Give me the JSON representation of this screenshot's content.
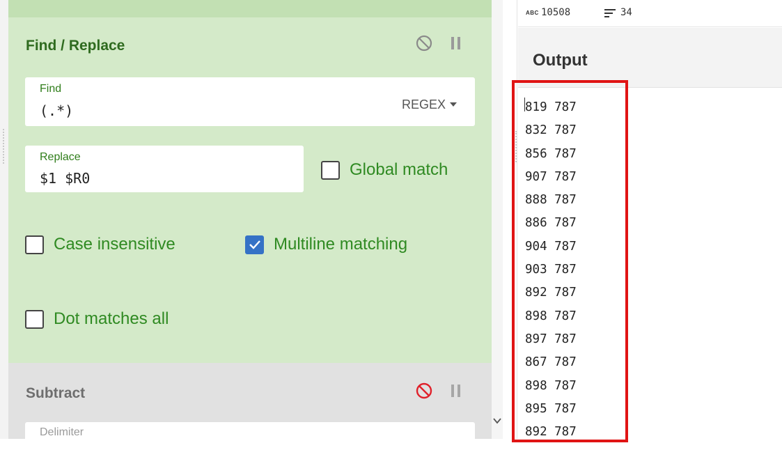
{
  "find_replace": {
    "title": "Find / Replace",
    "find_label": "Find",
    "find_value": "(.*)",
    "regex_option": "REGEX",
    "replace_label": "Replace",
    "replace_value": "$1 $R0",
    "global_match": {
      "label": "Global match",
      "checked": false
    },
    "case_insensitive": {
      "label": "Case insensitive",
      "checked": false
    },
    "multiline_matching": {
      "label": "Multiline matching",
      "checked": true
    },
    "dot_matches_all": {
      "label": "Dot matches all",
      "checked": false
    },
    "icons": [
      "disable-icon",
      "pause-icon"
    ]
  },
  "subtract": {
    "title": "Subtract",
    "delimiter_label": "Delimiter",
    "icons": [
      "disable-icon",
      "pause-icon"
    ]
  },
  "stats": {
    "chars_icon_text": "ABC",
    "chars": "10508",
    "lines": "34"
  },
  "output": {
    "title": "Output",
    "lines": [
      "819 787",
      "832 787",
      "856 787",
      "907 787",
      "888 787",
      "886 787",
      "904 787",
      "903 787",
      "892 787",
      "898 787",
      "897 787",
      "867 787",
      "898 787",
      "895 787",
      "892 787"
    ]
  },
  "colors": {
    "panel_green": "#d4eac9",
    "label_green": "#2f8a22",
    "checkbox_blue": "#3572c6",
    "disable_red": "#e0202a",
    "highlight_red": "#e01414"
  }
}
